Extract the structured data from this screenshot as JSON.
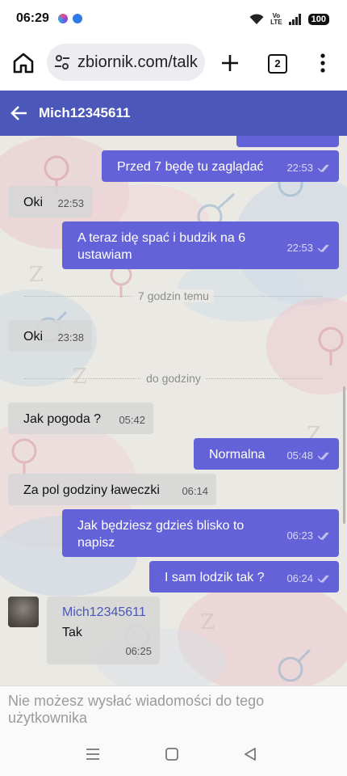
{
  "status_bar": {
    "time": "06:29",
    "volte_top": "Vo",
    "volte_bottom": "LTE",
    "battery": "100"
  },
  "browser": {
    "url": "zbiornik.com/talk",
    "tab_count": "2"
  },
  "chat": {
    "contact_name": "Mich12345611",
    "messages": [
      {
        "dir": "out",
        "text": "Przed 7 będę tu zaglądać",
        "time": "22:53"
      },
      {
        "dir": "in",
        "text": "Oki",
        "time": "22:53"
      },
      {
        "dir": "out",
        "text": "A teraz idę spać i budzik na 6 ustawiam",
        "time": "22:53"
      },
      {
        "dir": "in",
        "text": "Oki",
        "time": "23:38"
      },
      {
        "dir": "in",
        "text": "Jak pogoda ?",
        "time": "05:42"
      },
      {
        "dir": "out",
        "text": "Normalna",
        "time": "05:48"
      },
      {
        "dir": "in",
        "text": "Za pol godziny ławeczki",
        "time": "06:14"
      },
      {
        "dir": "out",
        "text": "Jak będziesz gdzieś blisko to napisz",
        "time": "06:23"
      },
      {
        "dir": "out",
        "text": "I sam lodzik tak ?",
        "time": "06:24"
      },
      {
        "dir": "in",
        "sender": "Mich12345611",
        "text": "Tak",
        "time": "06:25"
      }
    ],
    "dividers": [
      "7 godzin temu",
      "do godziny"
    ],
    "composer_notice": "Nie możesz wysłać wiadomości do tego użytkownika"
  },
  "colors": {
    "header": "#4b57b9",
    "outgoing": "#6462d8",
    "incoming": "#d6d6d6"
  }
}
